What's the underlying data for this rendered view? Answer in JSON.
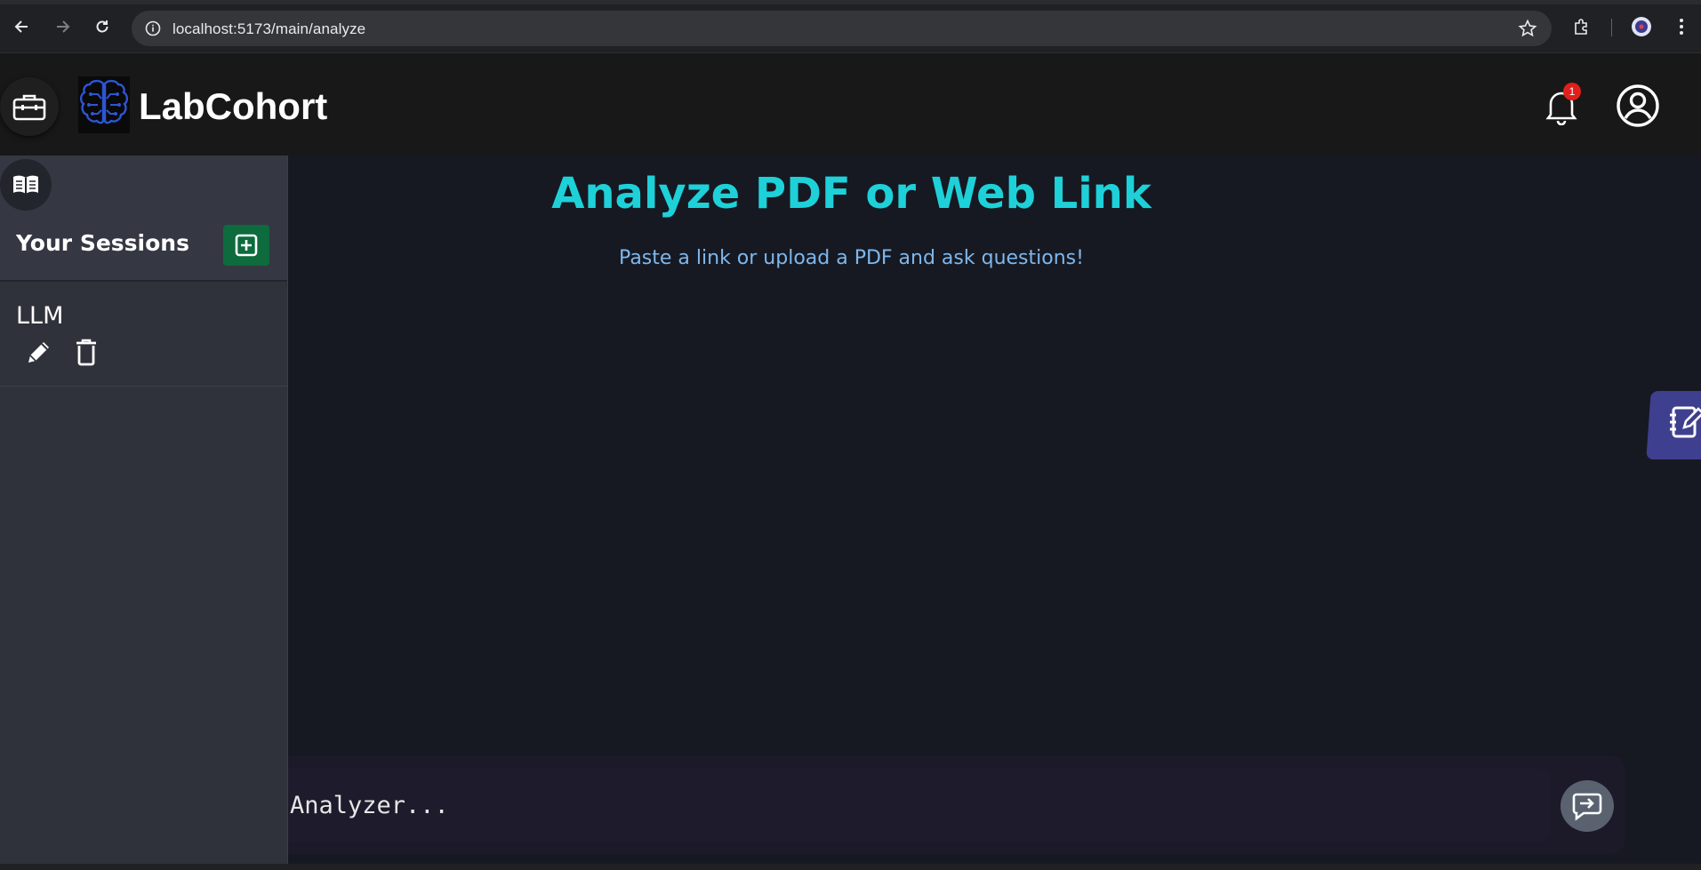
{
  "browser": {
    "url": "localhost:5173/main/analyze"
  },
  "header": {
    "brand": "LabCohort",
    "notification_count": "1"
  },
  "sidebar": {
    "title": "Your Sessions",
    "sessions": [
      {
        "name": "LLM"
      }
    ]
  },
  "main": {
    "title": "Analyze PDF or Web Link",
    "subtitle": "Paste a link or upload a PDF and ask questions!",
    "input_placeholder": "Analyzer..."
  },
  "colors": {
    "accent": "#1ed1d9",
    "subtitle": "#7fb7ec",
    "add_button": "#0d6b3d",
    "notes_tab": "#3f3f8f",
    "badge": "#e0201c"
  }
}
